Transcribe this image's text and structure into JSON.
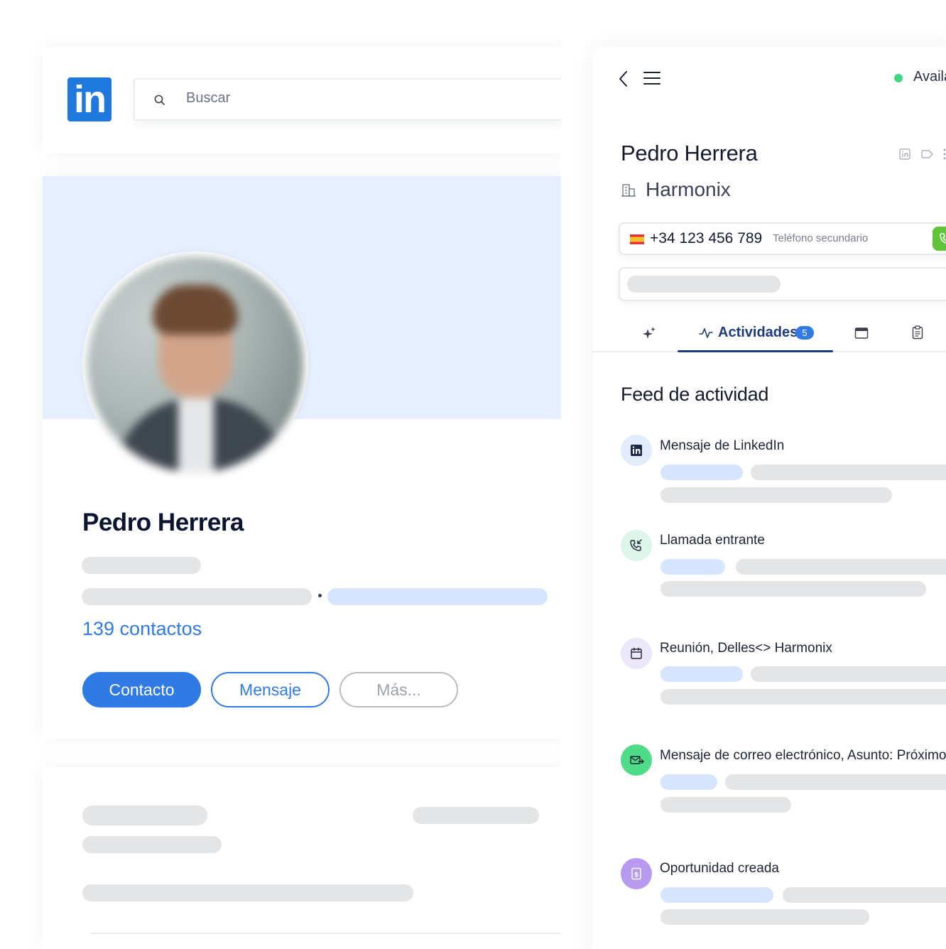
{
  "linkedin": {
    "logo_text": "in",
    "search": {
      "placeholder": "Buscar"
    },
    "profile": {
      "name": "Pedro Herrera",
      "contacts": "139 contactos"
    },
    "buttons": {
      "contact": "Contacto",
      "message": "Mensaje",
      "more": "Más..."
    }
  },
  "crm": {
    "status": "Available",
    "contact": {
      "name": "Pedro Herrera",
      "company": "Harmonix",
      "phone": "+34 123 456 789",
      "phone_label": "Teléfono secundario"
    },
    "tabs": {
      "activities_label": "Actividades",
      "activities_count": "5"
    },
    "feed": {
      "title": "Feed de actividad",
      "items": [
        {
          "label": "Mensaje de LinkedIn",
          "icon": "linkedin-icon"
        },
        {
          "label": "Llamada entrante",
          "icon": "incoming-call-icon"
        },
        {
          "label": "Reunión, Delles<> Harmonix",
          "icon": "calendar-icon"
        },
        {
          "label": "Mensaje de correo electrónico, Asunto: Próximos pasos",
          "icon": "email-icon"
        },
        {
          "label": "Oportunidad creada",
          "icon": "dollar-doc-icon"
        }
      ]
    }
  },
  "colors": {
    "linkedin_blue": "#1f78dd",
    "accent_blue": "#2f7ae5",
    "tab_navy": "#1e3b7a",
    "available_green": "#3fd67f",
    "call_green": "#5fc43a",
    "skeleton_gray": "#e4e5e7",
    "skeleton_blue": "#d7e5ff"
  }
}
